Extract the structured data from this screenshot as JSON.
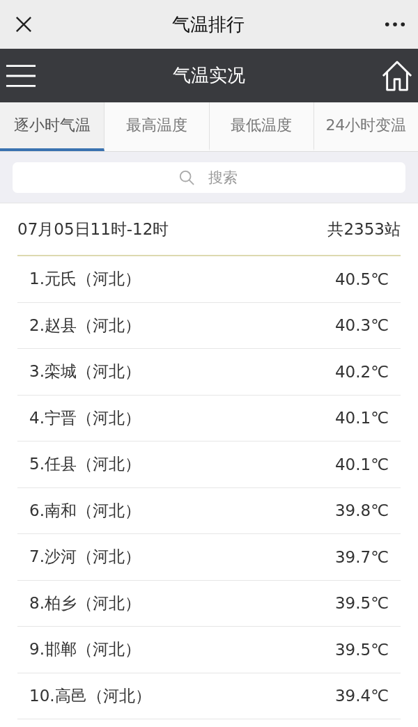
{
  "window": {
    "title": "气温排行"
  },
  "header": {
    "title": "气温实况"
  },
  "tabs": [
    {
      "label": "逐小时气温",
      "selected": true
    },
    {
      "label": "最高温度",
      "selected": false
    },
    {
      "label": "最低温度",
      "selected": false
    },
    {
      "label": "24小时变温",
      "selected": false
    }
  ],
  "search": {
    "placeholder": "搜索"
  },
  "summary": {
    "period": "07月05日11时-12时",
    "count": "共2353站"
  },
  "rows": [
    {
      "station": "1.元氏（河北）",
      "temperature": "40.5℃"
    },
    {
      "station": "2.赵县（河北）",
      "temperature": "40.3℃"
    },
    {
      "station": "3.栾城（河北）",
      "temperature": "40.2℃"
    },
    {
      "station": "4.宁晋（河北）",
      "temperature": "40.1℃"
    },
    {
      "station": "5.任县（河北）",
      "temperature": "40.1℃"
    },
    {
      "station": "6.南和（河北）",
      "temperature": "39.8℃"
    },
    {
      "station": "7.沙河（河北）",
      "temperature": "39.7℃"
    },
    {
      "station": "8.柏乡（河北）",
      "temperature": "39.5℃"
    },
    {
      "station": "9.邯郸（河北）",
      "temperature": "39.5℃"
    },
    {
      "station": "10.高邑（河北）",
      "temperature": "39.4℃"
    }
  ]
}
